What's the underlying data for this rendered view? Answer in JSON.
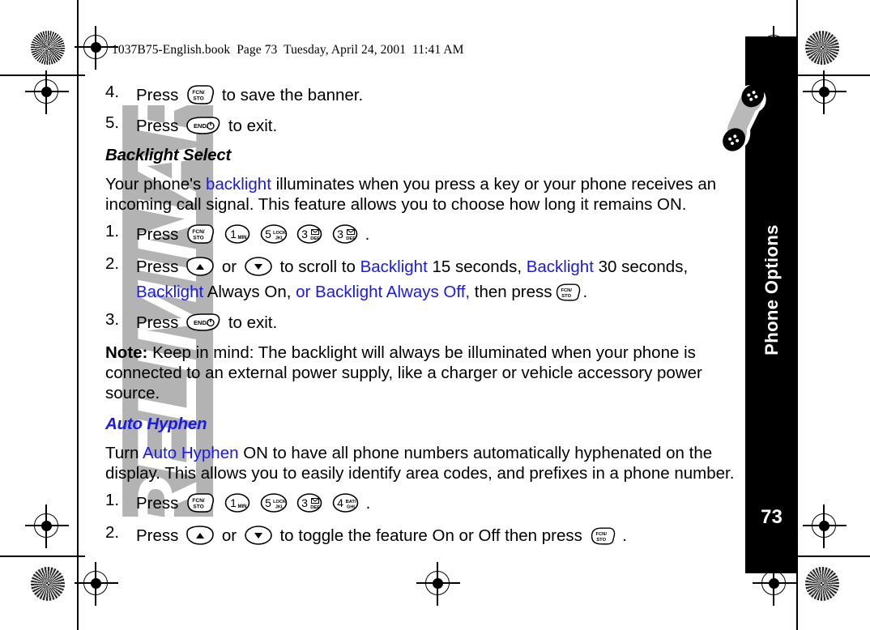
{
  "document": {
    "file_header": "1037B75-English.book  Page 73  Tuesday, April 24, 2001  11:41 AM",
    "watermark": "PRELIMINARY",
    "page_number": "73",
    "side_tab_title": "Phone Options",
    "accent_blue": "#1a1ae6",
    "tab_background": "#000000",
    "watermark_color": "#b3b3b3"
  },
  "content": {
    "step4": {
      "number": "4.",
      "press_label": "Press",
      "key": "FCN/STO",
      "tail": "to save the banner."
    },
    "step5": {
      "number": "5.",
      "press_label": "Press",
      "key": "END/PWR",
      "tail": "to exit."
    },
    "backlight": {
      "heading": "Backlight Select",
      "intro": "Your phone's ",
      "intro_link": "backlight",
      "intro_rest": " illuminates when you press a key or your phone receives an incoming call signal. This feature allows you to choose how long it remains ON.",
      "step1": {
        "number": "1.",
        "press_label": "Press",
        "keys": [
          "FCN/STO",
          "1 MIN",
          "5 LOCK JKL",
          "3 DEF",
          "3 DEF"
        ],
        "period": "."
      },
      "step2": {
        "number": "2.",
        "press_label": "Press",
        "or_label": "or",
        "scroll_to": "to scroll to",
        "opt1_link": "Backlight",
        "opt1_rest": " 15 seconds, ",
        "opt2_link": "Backlight",
        "opt2_rest": " 30 seconds,",
        "opt3_link": "Backlight",
        "opt3_rest": " Always On, ",
        "opt4_link": "or Backlight Always Off,",
        "then_press": " then press",
        "final_key": "FCN/STO",
        "period": "."
      },
      "step3": {
        "number": "3.",
        "press_label": "Press",
        "key": "END/PWR",
        "tail": "to exit."
      },
      "note_label": "Note:",
      "note_text": "  Keep in mind: The backlight will always be illuminated when your phone is connected to an external power supply, like a charger or vehicle accessory power source."
    },
    "autohyphen": {
      "heading": "Auto Hyphen",
      "intro": "Turn ",
      "intro_link": "Auto Hyphen",
      "intro_rest": " ON to have all phone numbers automatically hyphenated on the display. This allows you to easily identify area codes, and prefixes in a phone number.",
      "step1": {
        "number": "1.",
        "press_label": "Press",
        "keys": [
          "FCN/STO",
          "1 MIN",
          "5 LOCK JKL",
          "3 DEF",
          "4 BAT GHI"
        ],
        "period": "."
      },
      "step2": {
        "number": "2.",
        "press_label": "Press",
        "or_label": "or",
        "tail": "to toggle the feature On or Off then press",
        "final_key": "FCN/STO",
        "period": "."
      }
    }
  },
  "keys": {
    "fcn_sto": {
      "line1": "FCN/",
      "line2": "STO"
    },
    "end_pwr": {
      "label": "END/"
    },
    "k1": {
      "digit": "1",
      "sub": "MIN"
    },
    "k5": {
      "digit": "5",
      "sub1": "LOCK",
      "sub2": "JKL"
    },
    "k3": {
      "digit": "3",
      "sub": "DEF"
    },
    "k4": {
      "digit": "4",
      "sub1": "BAT/",
      "sub2": "GHI"
    },
    "scroll_up": "▲",
    "scroll_down": "▼"
  }
}
